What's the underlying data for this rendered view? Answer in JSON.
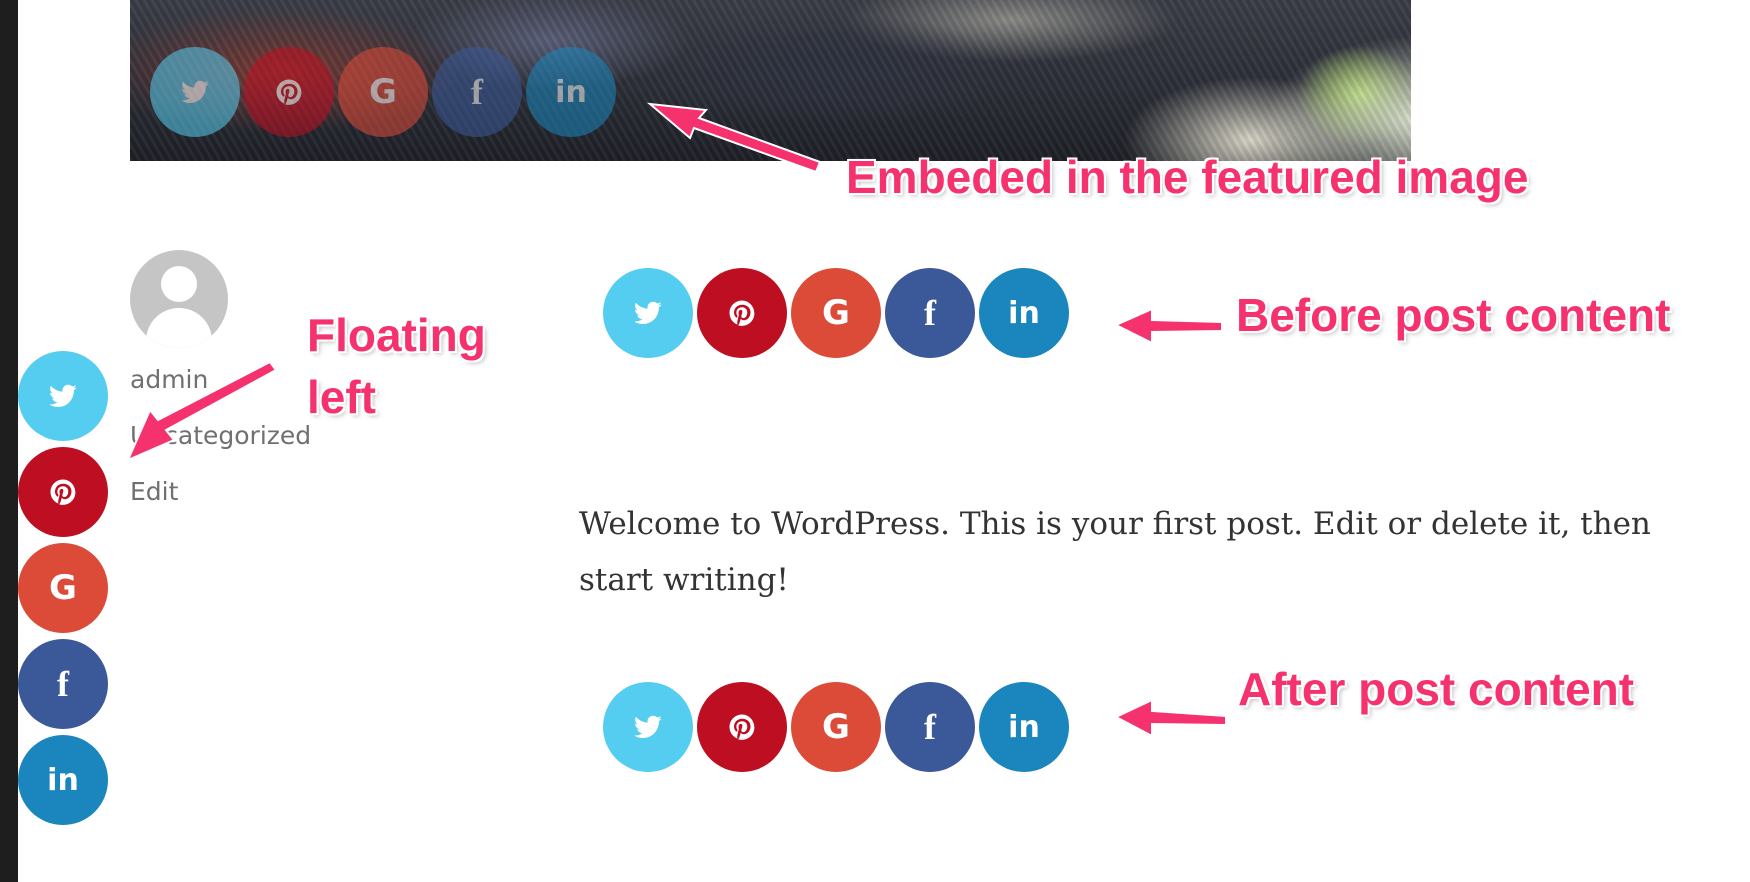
{
  "post": {
    "author": "admin",
    "category": "Uncategorized",
    "edit_label": "Edit",
    "content": "Welcome to WordPress. This is your first post. Edit or delete it, then start writing!"
  },
  "annotations": {
    "featured": "Embeded in the featured image",
    "before": "Before post content",
    "after": "After post content",
    "floating": "Floating left"
  },
  "share_buttons": [
    {
      "network": "twitter",
      "icon": "twitter-bird-icon",
      "color": "#55cdf0"
    },
    {
      "network": "pinterest",
      "icon": "pinterest-icon",
      "color": "#bd0e22"
    },
    {
      "network": "google",
      "icon": "google-g-icon",
      "glyph": "G",
      "color": "#dc4a38"
    },
    {
      "network": "facebook",
      "icon": "facebook-f-icon",
      "glyph": "f",
      "color": "#3b5998"
    },
    {
      "network": "linkedin",
      "icon": "linkedin-in-icon",
      "glyph": "in",
      "color": "#1b86bd"
    }
  ],
  "colors": {
    "annotation": "#f5326e",
    "sidebar": "#1e1e1e"
  }
}
